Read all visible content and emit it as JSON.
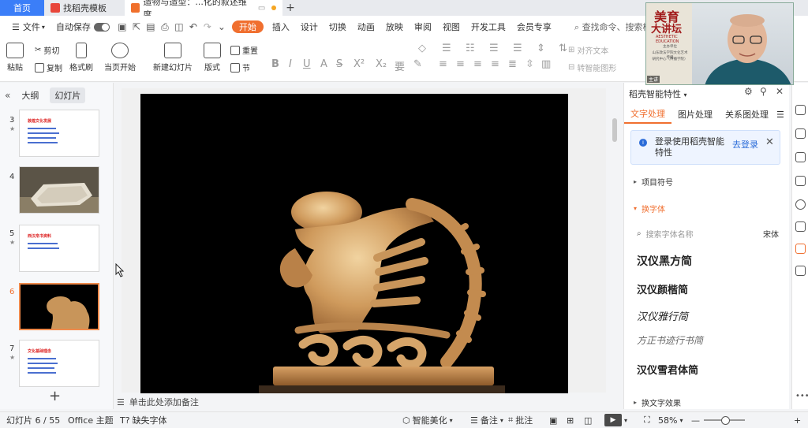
{
  "tabs": {
    "home": "首页",
    "template": "找稻壳模板",
    "document": "造物与造型：...化的叙述维度",
    "add": "+"
  },
  "menu": {
    "file": "文件",
    "autosave": "自动保存",
    "start": "开始",
    "items": [
      "插入",
      "设计",
      "切换",
      "动画",
      "放映",
      "审阅",
      "视图",
      "开发工具",
      "会员专享"
    ],
    "search": "查找命令、搜索模板"
  },
  "ribbon": {
    "paste": "粘贴",
    "cut": "剪切",
    "copy": "复制",
    "format_painter": "格式刷",
    "from_current": "当页开始",
    "new_slide": "新建幻灯片",
    "layout": "版式",
    "section": "节",
    "reset": "重置",
    "align_text": "对齐文本",
    "convert_smartart": "转智能图形"
  },
  "left_panel": {
    "outline_tab": "大纲",
    "slides_tab": "幻灯片",
    "slide_numbers": [
      "3",
      "4",
      "5",
      "6",
      "7"
    ],
    "thumb_titles": [
      "敦煌文化发展",
      "",
      "西汉帛书资料",
      "",
      "文化基础理念"
    ]
  },
  "notes": {
    "placeholder": "单击此处添加备注"
  },
  "right_panel": {
    "title": "稻壳智能特性",
    "tabs": [
      "文字处理",
      "图片处理",
      "关系图处理"
    ],
    "login_msg": "登录使用稻壳智能特性",
    "login_link": "去登录",
    "bullets": "项目符号",
    "change_font": "换字体",
    "font_search_placeholder": "搜索字体名称",
    "current_font": "宋体",
    "fonts": [
      "汉仪黑方简",
      "汉仪颜楷简",
      "汉仪雅行简",
      "方正书迹行书简",
      "汉仪雪君体简"
    ],
    "change_effect": "换文字效果"
  },
  "webcam": {
    "poster_title1": "美育",
    "poster_title2": "大讲坛",
    "poster_sub": "AESTHETIC EDUCATION",
    "poster_line1": "主办单位",
    "poster_line2": "山东政法学院文化艺术传播",
    "poster_line3": "研究中心（传播学院）",
    "name_tag": "主讲"
  },
  "status": {
    "slide_counter": "幻灯片 6 / 55",
    "theme": "Office 主题",
    "missing_font": "缺失字体",
    "smart_beautify": "智能美化",
    "notes": "备注",
    "comments": "批注",
    "zoom": "58%"
  },
  "colors": {
    "accent_orange": "#f06f2f",
    "tab_blue": "#3b7ef8",
    "link_blue": "#2a6bd8"
  }
}
